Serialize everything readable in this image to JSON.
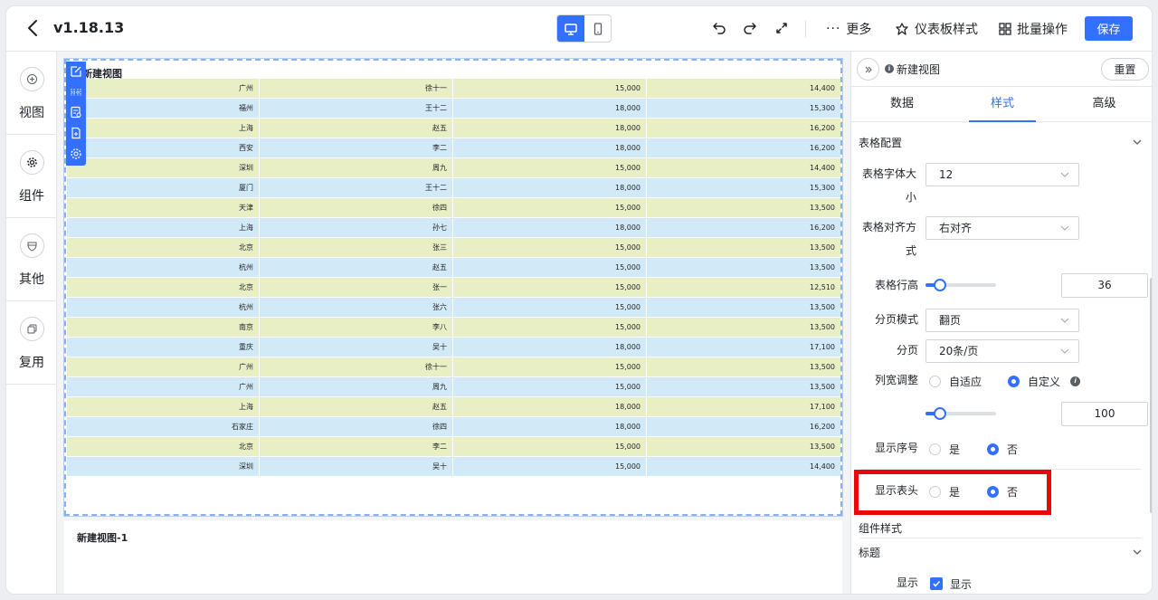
{
  "header": {
    "version": "v1.18.13",
    "more_label": "更多",
    "dashboard_style_label": "仪表板样式",
    "batch_label": "批量操作",
    "save_label": "保存"
  },
  "leftnav": {
    "items": [
      {
        "label": "视图",
        "icon": "plus-circle-icon"
      },
      {
        "label": "组件",
        "icon": "gear-icon"
      },
      {
        "label": "其他",
        "icon": "shield-icon"
      },
      {
        "label": "复用",
        "icon": "copy-icon"
      }
    ]
  },
  "canvas": {
    "widget_title": "新建视图",
    "widget2_title": "新建视图-1",
    "rows": [
      [
        "广州",
        "徐十一",
        "15,000",
        "14,400"
      ],
      [
        "福州",
        "王十二",
        "18,000",
        "15,300"
      ],
      [
        "上海",
        "赵五",
        "18,000",
        "16,200"
      ],
      [
        "西安",
        "李二",
        "18,000",
        "16,200"
      ],
      [
        "深圳",
        "周九",
        "15,000",
        "14,400"
      ],
      [
        "厦门",
        "王十二",
        "18,000",
        "15,300"
      ],
      [
        "天津",
        "徐四",
        "15,000",
        "13,500"
      ],
      [
        "上海",
        "孙七",
        "18,000",
        "16,200"
      ],
      [
        "北京",
        "张三",
        "15,000",
        "13,500"
      ],
      [
        "杭州",
        "赵五",
        "15,000",
        "13,500"
      ],
      [
        "北京",
        "张一",
        "15,000",
        "12,510"
      ],
      [
        "杭州",
        "张六",
        "15,000",
        "13,500"
      ],
      [
        "南京",
        "李八",
        "15,000",
        "13,500"
      ],
      [
        "重庆",
        "吴十",
        "18,000",
        "17,100"
      ],
      [
        "广州",
        "徐十一",
        "15,000",
        "13,500"
      ],
      [
        "广州",
        "周九",
        "15,000",
        "13,500"
      ],
      [
        "上海",
        "赵五",
        "18,000",
        "17,100"
      ],
      [
        "石家庄",
        "徐四",
        "18,000",
        "16,200"
      ],
      [
        "北京",
        "李二",
        "15,000",
        "13,500"
      ],
      [
        "深圳",
        "吴十",
        "15,000",
        "14,400"
      ]
    ]
  },
  "panel": {
    "title": "新建视图",
    "reset_label": "重置",
    "tabs": [
      "数据",
      "样式",
      "高级"
    ],
    "active_tab": "样式",
    "section_table": "表格配置",
    "font_size_label": "表格字体大小",
    "font_size_value": "12",
    "align_label": "表格对齐方式",
    "align_value": "右对齐",
    "row_height_label": "表格行高",
    "row_height_value": "36",
    "row_height_fraction": 0.2,
    "paging_mode_label": "分页模式",
    "paging_mode_value": "翻页",
    "paging_label": "分页",
    "paging_value": "20条/页",
    "col_width_label": "列宽调整",
    "col_width_opt_auto": "自适应",
    "col_width_opt_custom": "自定义",
    "col_width_value": "100",
    "col_width_fraction": 0.2,
    "show_index_label": "显示序号",
    "show_header_label": "显示表头",
    "yes": "是",
    "no": "否",
    "section_component": "组件样式",
    "section_title": "标题",
    "show_label": "显示",
    "show_check_label": "显示",
    "accent_color": "#3370ff",
    "highlight_color": "#e8080c"
  }
}
